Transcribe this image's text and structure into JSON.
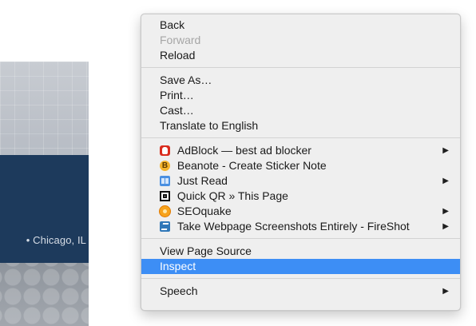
{
  "background_page": {
    "location_text": "• Chicago, IL"
  },
  "context_menu": {
    "groups": [
      {
        "items": [
          {
            "label": "Back",
            "enabled": true
          },
          {
            "label": "Forward",
            "enabled": false
          },
          {
            "label": "Reload",
            "enabled": true
          }
        ]
      },
      {
        "items": [
          {
            "label": "Save As…",
            "enabled": true
          },
          {
            "label": "Print…",
            "enabled": true
          },
          {
            "label": "Cast…",
            "enabled": true
          },
          {
            "label": "Translate to English",
            "enabled": true
          }
        ]
      },
      {
        "items": [
          {
            "label": "AdBlock — best ad blocker",
            "icon": "adblock-icon",
            "has_submenu": true
          },
          {
            "label": "Beanote - Create Sticker Note",
            "icon": "beanote-icon",
            "icon_letter": "B",
            "has_submenu": false
          },
          {
            "label": "Just Read",
            "icon": "just-read-icon",
            "has_submenu": true
          },
          {
            "label": "Quick QR » This Page",
            "icon": "qr-code-icon",
            "has_submenu": false
          },
          {
            "label": "SEOquake",
            "icon": "seoquake-icon",
            "has_submenu": true
          },
          {
            "label": "Take Webpage Screenshots Entirely - FireShot",
            "icon": "fireshot-icon",
            "has_submenu": true
          }
        ]
      },
      {
        "items": [
          {
            "label": "View Page Source",
            "enabled": true
          },
          {
            "label": "Inspect",
            "enabled": true,
            "highlighted": true
          }
        ]
      },
      {
        "items": [
          {
            "label": "Speech",
            "has_submenu": true
          }
        ]
      }
    ],
    "submenu_arrow": "▶",
    "highlight_color": "#3d8ef5",
    "disabled_color": "#a6a6a6"
  }
}
